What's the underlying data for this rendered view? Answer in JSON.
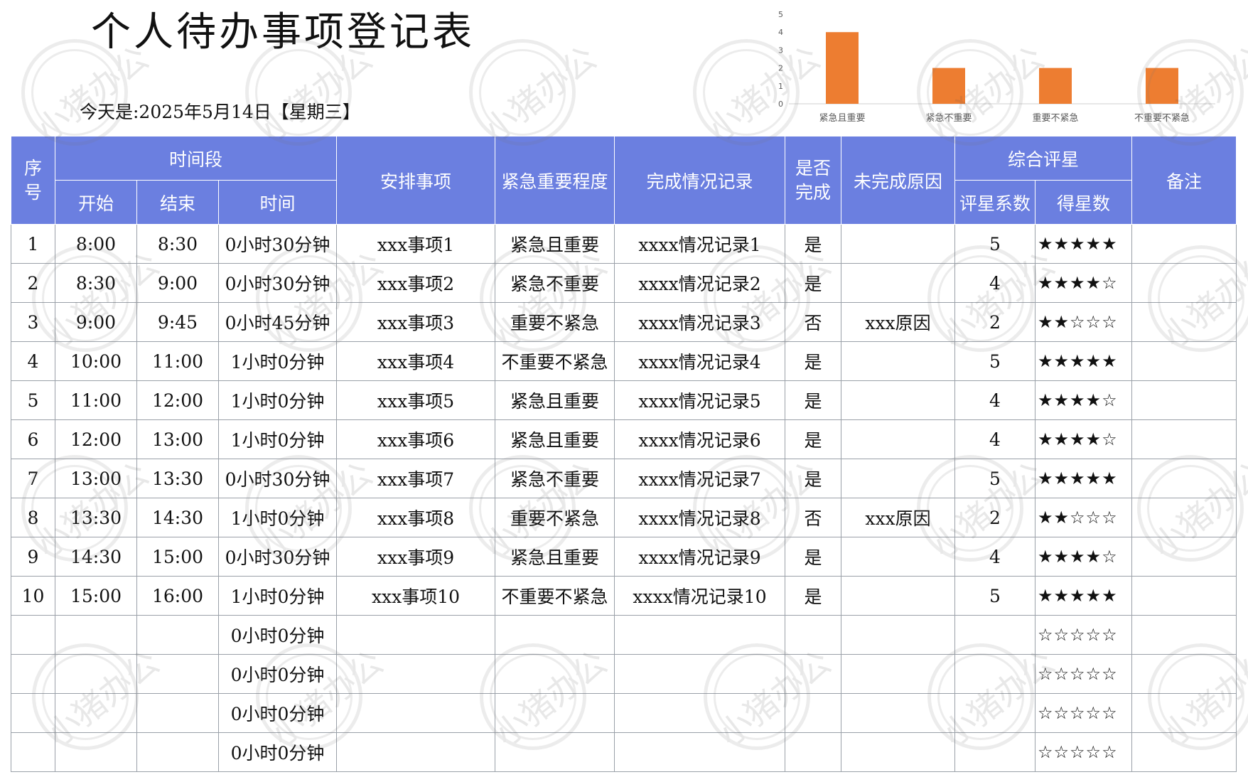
{
  "title": "个人待办事项登记表",
  "date_line": "今天是:2025年5月14日【星期三】",
  "chart_data": {
    "type": "bar",
    "categories": [
      "紧急且重要",
      "紧急不重要",
      "重要不紧急",
      "不重要不紧急"
    ],
    "values": [
      4,
      2,
      2,
      2
    ],
    "ylim": [
      0,
      5
    ],
    "yticks": [
      "0",
      "1",
      "2",
      "3",
      "4",
      "5"
    ],
    "bar_color": "#ed7d31",
    "grid": false,
    "title": "",
    "xlabel": "",
    "ylabel": ""
  },
  "header": {
    "seq": "序号",
    "time_range": "时间段",
    "start": "开始",
    "end": "结束",
    "duration": "时间",
    "task": "安排事项",
    "priority": "紧急重要程度",
    "completion_record": "完成情况记录",
    "done": "是否完成",
    "reason": "未完成原因",
    "rating_group": "综合评星",
    "rating_coef": "评星系数",
    "stars": "得星数",
    "remarks": "备注",
    "header_color": "#6b7fe0"
  },
  "rows": [
    {
      "seq": "1",
      "start": "8:00",
      "end": "8:30",
      "duration": "0小时30分钟",
      "task": "xxx事项1",
      "priority": "紧急且重要",
      "record": "xxxx情况记录1",
      "done": "是",
      "reason": "",
      "coef": "5",
      "stars": "★★★★★",
      "remarks": ""
    },
    {
      "seq": "2",
      "start": "8:30",
      "end": "9:00",
      "duration": "0小时30分钟",
      "task": "xxx事项2",
      "priority": "紧急不重要",
      "record": "xxxx情况记录2",
      "done": "是",
      "reason": "",
      "coef": "4",
      "stars": "★★★★☆",
      "remarks": ""
    },
    {
      "seq": "3",
      "start": "9:00",
      "end": "9:45",
      "duration": "0小时45分钟",
      "task": "xxx事项3",
      "priority": "重要不紧急",
      "record": "xxxx情况记录3",
      "done": "否",
      "reason": "xxx原因",
      "coef": "2",
      "stars": "★★☆☆☆",
      "remarks": ""
    },
    {
      "seq": "4",
      "start": "10:00",
      "end": "11:00",
      "duration": "1小时0分钟",
      "task": "xxx事项4",
      "priority": "不重要不紧急",
      "record": "xxxx情况记录4",
      "done": "是",
      "reason": "",
      "coef": "5",
      "stars": "★★★★★",
      "remarks": ""
    },
    {
      "seq": "5",
      "start": "11:00",
      "end": "12:00",
      "duration": "1小时0分钟",
      "task": "xxx事项5",
      "priority": "紧急且重要",
      "record": "xxxx情况记录5",
      "done": "是",
      "reason": "",
      "coef": "4",
      "stars": "★★★★☆",
      "remarks": ""
    },
    {
      "seq": "6",
      "start": "12:00",
      "end": "13:00",
      "duration": "1小时0分钟",
      "task": "xxx事项6",
      "priority": "紧急且重要",
      "record": "xxxx情况记录6",
      "done": "是",
      "reason": "",
      "coef": "4",
      "stars": "★★★★☆",
      "remarks": ""
    },
    {
      "seq": "7",
      "start": "13:00",
      "end": "13:30",
      "duration": "0小时30分钟",
      "task": "xxx事项7",
      "priority": "紧急不重要",
      "record": "xxxx情况记录7",
      "done": "是",
      "reason": "",
      "coef": "5",
      "stars": "★★★★★",
      "remarks": ""
    },
    {
      "seq": "8",
      "start": "13:30",
      "end": "14:30",
      "duration": "1小时0分钟",
      "task": "xxx事项8",
      "priority": "重要不紧急",
      "record": "xxxx情况记录8",
      "done": "否",
      "reason": "xxx原因",
      "coef": "2",
      "stars": "★★☆☆☆",
      "remarks": ""
    },
    {
      "seq": "9",
      "start": "14:30",
      "end": "15:00",
      "duration": "0小时30分钟",
      "task": "xxx事项9",
      "priority": "紧急且重要",
      "record": "xxxx情况记录9",
      "done": "是",
      "reason": "",
      "coef": "4",
      "stars": "★★★★☆",
      "remarks": ""
    },
    {
      "seq": "10",
      "start": "15:00",
      "end": "16:00",
      "duration": "1小时0分钟",
      "task": "xxx事项10",
      "priority": "不重要不紧急",
      "record": "xxxx情况记录10",
      "done": "是",
      "reason": "",
      "coef": "5",
      "stars": "★★★★★",
      "remarks": ""
    },
    {
      "seq": "",
      "start": "",
      "end": "",
      "duration": "0小时0分钟",
      "task": "",
      "priority": "",
      "record": "",
      "done": "",
      "reason": "",
      "coef": "",
      "stars": "☆☆☆☆☆",
      "remarks": ""
    },
    {
      "seq": "",
      "start": "",
      "end": "",
      "duration": "0小时0分钟",
      "task": "",
      "priority": "",
      "record": "",
      "done": "",
      "reason": "",
      "coef": "",
      "stars": "☆☆☆☆☆",
      "remarks": ""
    },
    {
      "seq": "",
      "start": "",
      "end": "",
      "duration": "0小时0分钟",
      "task": "",
      "priority": "",
      "record": "",
      "done": "",
      "reason": "",
      "coef": "",
      "stars": "☆☆☆☆☆",
      "remarks": ""
    },
    {
      "seq": "",
      "start": "",
      "end": "",
      "duration": "0小时0分钟",
      "task": "",
      "priority": "",
      "record": "",
      "done": "",
      "reason": "",
      "coef": "",
      "stars": "☆☆☆☆☆",
      "remarks": ""
    }
  ],
  "watermark": {
    "text": "小猪办公"
  }
}
